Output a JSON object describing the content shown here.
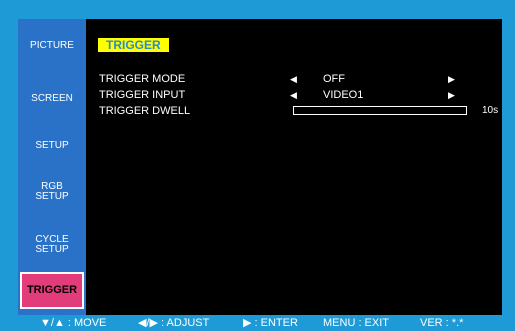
{
  "sidebar": {
    "items": [
      {
        "label": "PICTURE"
      },
      {
        "label": "SCREEN"
      },
      {
        "label": "SETUP"
      },
      {
        "label_line1": "RGB",
        "label_line2": "SETUP"
      },
      {
        "label_line1": "CYCLE",
        "label_line2": "SETUP"
      },
      {
        "label": "TRIGGER",
        "active": true
      }
    ]
  },
  "panel": {
    "title": "TRIGGER",
    "rows": [
      {
        "label": "TRIGGER MODE",
        "value": "OFF",
        "left_arrow": "◀",
        "right_arrow": "▶"
      },
      {
        "label": "TRIGGER INPUT",
        "value": "VIDEO1",
        "left_arrow": "◀",
        "right_arrow": "▶"
      },
      {
        "label": "TRIGGER DWELL",
        "value": "10s",
        "fill": 0
      }
    ]
  },
  "footer": {
    "move": "▼/▲ : MOVE",
    "adjust": "◀/▶ : ADJUST",
    "enter": "▶ : ENTER",
    "exit": "MENU : EXIT",
    "ver": "VER : *.*"
  },
  "colors": {
    "background": "#1e9bd7",
    "sidebar": "#2a72c8",
    "active_item": "#e23c7a",
    "title_badge": "#ffff00",
    "title_text": "#2a8bd0"
  }
}
